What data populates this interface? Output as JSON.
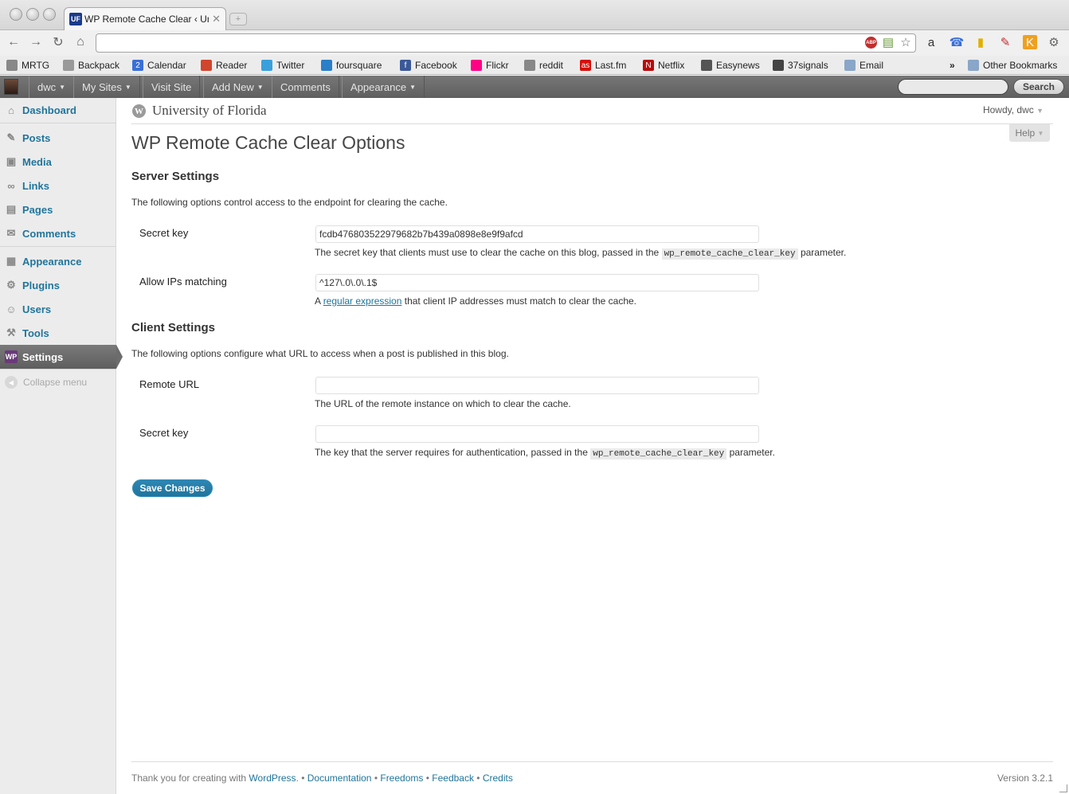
{
  "browser": {
    "tab_title": "WP Remote Cache Clear ‹ Uni",
    "tab_favicon_text": "UF",
    "address_value": "",
    "bookmarks": [
      {
        "label": "MRTG",
        "icon": "globe-icon",
        "color": "#888888"
      },
      {
        "label": "Backpack",
        "icon": "backpack-icon",
        "color": "#999999"
      },
      {
        "label": "Calendar",
        "icon": "calendar-icon",
        "color": "#3a6fd8",
        "glyph": "2"
      },
      {
        "label": "Reader",
        "icon": "reader-icon",
        "color": "#d0452e"
      },
      {
        "label": "Twitter",
        "icon": "twitter-icon",
        "color": "#3aa0dc"
      },
      {
        "label": "foursquare",
        "icon": "foursquare-icon",
        "color": "#2a7fc8"
      },
      {
        "label": "Facebook",
        "icon": "facebook-icon",
        "color": "#3b5998",
        "glyph": "f"
      },
      {
        "label": "Flickr",
        "icon": "flickr-icon",
        "color": "#ff0084"
      },
      {
        "label": "reddit",
        "icon": "reddit-icon",
        "color": "#888888"
      },
      {
        "label": "Last.fm",
        "icon": "lastfm-icon",
        "color": "#d51007",
        "glyph": "as"
      },
      {
        "label": "Netflix",
        "icon": "netflix-icon",
        "color": "#b9090b",
        "glyph": "N"
      },
      {
        "label": "Easynews",
        "icon": "easynews-icon",
        "color": "#555555"
      },
      {
        "label": "37signals",
        "icon": "37signals-icon",
        "color": "#444444"
      },
      {
        "label": "Email",
        "icon": "folder-icon",
        "color": "#8aa6c8"
      }
    ],
    "other_bookmarks": "Other Bookmarks",
    "overflow": "»"
  },
  "adminbar": {
    "items": [
      {
        "label": "dwc",
        "caret": true
      },
      {
        "label": "My Sites",
        "caret": true
      },
      {
        "label": "Visit Site",
        "caret": false
      },
      {
        "label": "Add New",
        "caret": true
      },
      {
        "label": "Comments",
        "caret": false
      },
      {
        "label": "Appearance",
        "caret": true
      }
    ],
    "search_button": "Search",
    "search_value": ""
  },
  "sidebar": {
    "items": [
      {
        "label": "Dashboard",
        "icon": "dashboard-icon"
      },
      {
        "label": "Posts",
        "icon": "pin-icon"
      },
      {
        "label": "Media",
        "icon": "media-icon"
      },
      {
        "label": "Links",
        "icon": "link-icon"
      },
      {
        "label": "Pages",
        "icon": "pages-icon"
      },
      {
        "label": "Comments",
        "icon": "comment-icon"
      },
      {
        "label": "Appearance",
        "icon": "appearance-icon"
      },
      {
        "label": "Plugins",
        "icon": "plugin-icon"
      },
      {
        "label": "Users",
        "icon": "users-icon"
      },
      {
        "label": "Tools",
        "icon": "tools-icon"
      },
      {
        "label": "Settings",
        "icon": "settings-icon"
      }
    ],
    "current": "Settings",
    "collapse_label": "Collapse menu"
  },
  "header": {
    "site_title": "University of Florida",
    "howdy": "Howdy, dwc",
    "help": "Help"
  },
  "page": {
    "title": "WP Remote Cache Clear Options",
    "server": {
      "heading": "Server Settings",
      "desc": "The following options control access to the endpoint for clearing the cache.",
      "secret_label": "Secret key",
      "secret_value": "fcdb476803522979682b7b439a0898e8e9f9afcd",
      "secret_desc_pre": "The secret key that clients must use to clear the cache on this blog, passed in the",
      "secret_desc_code": "wp_remote_cache_clear_key",
      "secret_desc_post": "parameter.",
      "ips_label": "Allow IPs matching",
      "ips_value": "^127\\.0\\.0\\.1$",
      "ips_desc_pre": "A",
      "ips_desc_link": "regular expression",
      "ips_desc_post": "that client IP addresses must match to clear the cache."
    },
    "client": {
      "heading": "Client Settings",
      "desc": "The following options configure what URL to access when a post is published in this blog.",
      "url_label": "Remote URL",
      "url_value": "",
      "url_desc": "The URL of the remote instance on which to clear the cache.",
      "secret_label": "Secret key",
      "secret_value": "",
      "secret_desc_pre": "The key that the server requires for authentication, passed in the",
      "secret_desc_code": "wp_remote_cache_clear_key",
      "secret_desc_post": "parameter."
    },
    "save_label": "Save Changes"
  },
  "footer": {
    "thanks_pre": "Thank you for creating with",
    "wordpress": "WordPress",
    "links": [
      "Documentation",
      "Freedoms",
      "Feedback",
      "Credits"
    ],
    "version": "Version 3.2.1"
  }
}
